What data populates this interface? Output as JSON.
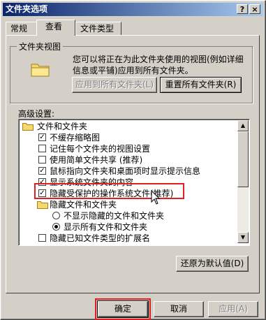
{
  "window": {
    "title": "文件夹选项",
    "help_glyph": "?",
    "close_glyph": "×"
  },
  "tabs": [
    {
      "label": "常规"
    },
    {
      "label": "查看",
      "active": true
    },
    {
      "label": "文件类型"
    }
  ],
  "folder_views": {
    "legend": "文件夹视图",
    "description": "您可以将正在为此文件夹使用的视图(例如详细信息或平铺)应用到所有文件夹。",
    "apply_all_label": "应用到所有文件夹(L)",
    "reset_all_label": "重置所有文件夹(R)"
  },
  "advanced": {
    "label": "高级设置:",
    "items": [
      {
        "type": "folder",
        "label": "文件和文件夹"
      },
      {
        "type": "checkbox",
        "checked": true,
        "label": "不缓存缩略图"
      },
      {
        "type": "checkbox",
        "checked": false,
        "label": "记住每个文件夹的视图设置"
      },
      {
        "type": "checkbox",
        "checked": false,
        "label": "使用简单文件共享 (推荐)"
      },
      {
        "type": "checkbox",
        "checked": true,
        "label": "鼠标指向文件夹和桌面项时显示提示信息"
      },
      {
        "type": "checkbox",
        "checked": true,
        "label": "显示系统文件夹的内容"
      },
      {
        "type": "checkbox",
        "checked": true,
        "label": "隐藏受保护的操作系统文件(推荐)"
      },
      {
        "type": "folder",
        "label": "隐藏文件和文件夹"
      },
      {
        "type": "radio",
        "checked": false,
        "label": "不显示隐藏的文件和文件夹"
      },
      {
        "type": "radio",
        "checked": true,
        "label": "显示所有文件和文件夹"
      },
      {
        "type": "checkbox",
        "checked": false,
        "label": "隐藏已知文件类型的扩展名"
      }
    ],
    "restore_defaults_label": "还原为默认值(D)"
  },
  "footer": {
    "ok_label": "确定",
    "cancel_label": "取消",
    "apply_label": "应用(A)"
  },
  "colors": {
    "highlight": "#e02020",
    "title_start": "#0a246a",
    "title_end": "#a6caf0"
  }
}
